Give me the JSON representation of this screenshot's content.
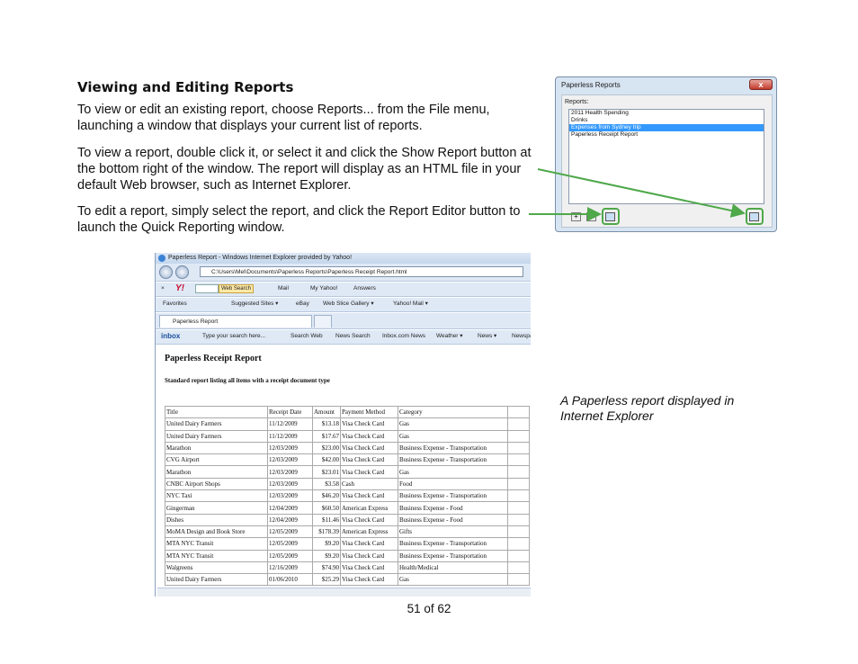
{
  "heading": "Viewing and Editing Reports",
  "paragraphs": [
    "To view or edit an existing report, choose Reports... from the File menu, launching a window that displays your current list of reports.",
    "To view a report, double click it, or select it and click the Show Report button at the bottom right of the window. The report will display as an HTML file in your default Web browser, such as Internet Explorer.",
    "To edit a report, simply select the report, and click the Report Editor button to launch the Quick Reporting window."
  ],
  "caption": "A Paperless report displayed in Internet Explorer",
  "page_number": "51 of 62",
  "dialog": {
    "title": "Paperless Reports",
    "close_label": "x",
    "reports_label": "Reports:",
    "reports": [
      "2011 Health Spending",
      "Drinks",
      "Expenses from Sydney trip",
      "Paperless Receipt Report"
    ],
    "selected_index": 2,
    "add_label": "+",
    "remove_label": "-",
    "highlight_color": "#4fa84a"
  },
  "browser": {
    "window_title": "Paperless Report - Windows Internet Explorer provided by Yahoo!",
    "address": "C:\\Users\\Mel\\Documents\\Paperless Reports\\Paperless Receipt Report.html",
    "yahoo_toolbar": {
      "close": "×",
      "logo": "Y!",
      "web_search": "Web Search",
      "items": [
        "Mail",
        "My Yahoo!",
        "Answers"
      ]
    },
    "favorites": {
      "label": "Favorites",
      "items": [
        "Suggested Sites ▾",
        "eBay",
        "Web Slice Gallery ▾",
        "Yahoo! Mail ▾"
      ]
    },
    "tab_label": "Paperless Report",
    "inbox_toolbar": {
      "logo": "inbox",
      "search_placeholder": "Type your search here...",
      "items": [
        "Search Web",
        "News Search",
        "Inbox.com News",
        "Weather ▾",
        "News ▾",
        "Newspa"
      ]
    }
  },
  "report": {
    "title": "Paperless Receipt Report",
    "subtitle": "Standard report listing all items with a receipt document type",
    "columns": [
      "Title",
      "Receipt Date",
      "Amount",
      "Payment Method",
      "Category"
    ],
    "rows": [
      [
        "United Dairy Farmers",
        "11/12/2009",
        "$13.18",
        "Visa Check Card",
        "Gas"
      ],
      [
        "United Dairy Farmers",
        "11/12/2009",
        "$17.67",
        "Visa Check Card",
        "Gas"
      ],
      [
        "Marathon",
        "12/03/2009",
        "$23.00",
        "Visa Check Card",
        "Business Expense - Transportation"
      ],
      [
        "CVG Airport",
        "12/03/2009",
        "$42.00",
        "Visa Check Card",
        "Business Expense - Transportation"
      ],
      [
        "Marathon",
        "12/03/2009",
        "$23.01",
        "Visa Check Card",
        "Gas"
      ],
      [
        "CNBC Airport Shops",
        "12/03/2009",
        "$3.58",
        "Cash",
        "Food"
      ],
      [
        "NYC Taxi",
        "12/03/2009",
        "$46.20",
        "Visa Check Card",
        "Business Expense - Transportation"
      ],
      [
        "Gingerman",
        "12/04/2009",
        "$60.50",
        "American Express",
        "Business Expense - Food"
      ],
      [
        "Dishes",
        "12/04/2009",
        "$11.46",
        "Visa Check Card",
        "Business Expense - Food"
      ],
      [
        "MoMA Design and Book Store",
        "12/05/2009",
        "$178.39",
        "American Express",
        "Gifts"
      ],
      [
        "MTA NYC Transit",
        "12/05/2009",
        "$9.20",
        "Visa Check Card",
        "Business Expense - Transportation"
      ],
      [
        "MTA NYC Transit",
        "12/05/2009",
        "$9.20",
        "Visa Check Card",
        "Business Expense - Transportation"
      ],
      [
        "Walgreens",
        "12/16/2009",
        "$74.90",
        "Visa Check Card",
        "Health/Medical"
      ],
      [
        "United Dairy Farmers",
        "01/06/2010",
        "$25.29",
        "Visa Check Card",
        "Gas"
      ]
    ]
  }
}
